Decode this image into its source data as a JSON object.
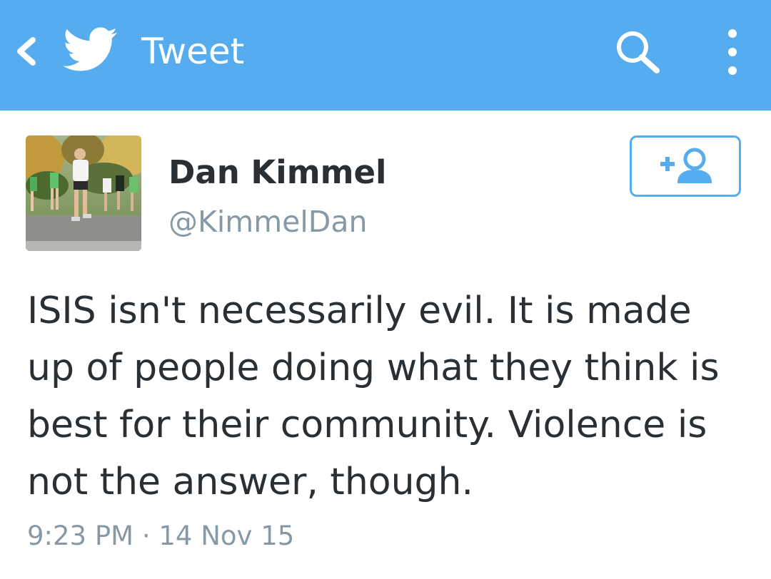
{
  "app_bar": {
    "title": "Tweet",
    "color": "#55acee",
    "back_icon": "chevron-left-icon",
    "logo_icon": "twitter-bird-icon",
    "search_icon": "search-icon",
    "overflow_icon": "more-vertical-icon"
  },
  "tweet": {
    "author": {
      "name": "Dan Kimmel",
      "handle": "@KimmelDan",
      "avatar": "photo of runners in a race"
    },
    "follow_icon": "follow-user-icon",
    "text": "ISIS isn't necessarily evil. It is made up of people doing what they think is best for their community. Violence is not the answer, though.",
    "time": "9:23 PM",
    "separator": "·",
    "date": "14 Nov 15"
  }
}
